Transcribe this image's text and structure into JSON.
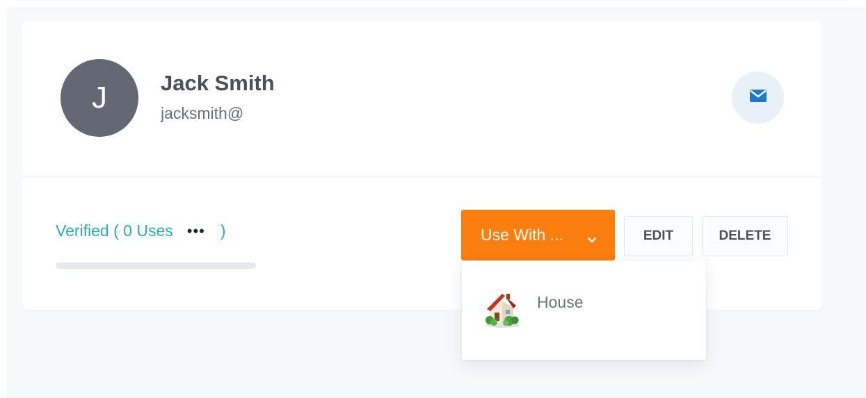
{
  "profile": {
    "avatar_initial": "J",
    "name": "Jack Smith",
    "email": "jacksmith@"
  },
  "icons": {
    "mail": "envelope-icon",
    "more": "ellipsis-icon",
    "chevron": "chevron-down-icon",
    "house": "house-icon"
  },
  "status": {
    "verified_text": "Verified ( 0 Uses",
    "more_label": "•••",
    "close_paren": ")",
    "progress": 0
  },
  "actions": {
    "use_with_label": "Use With ...",
    "edit_label": "EDIT",
    "delete_label": "DELETE"
  },
  "dropdown": {
    "items": [
      {
        "label": "House",
        "icon": "house-icon"
      }
    ]
  },
  "colors": {
    "accent_orange": "#fb7e0f",
    "verified_teal": "#25b3a4",
    "avatar_gray": "#636873",
    "mail_blue": "#1d79c9"
  }
}
